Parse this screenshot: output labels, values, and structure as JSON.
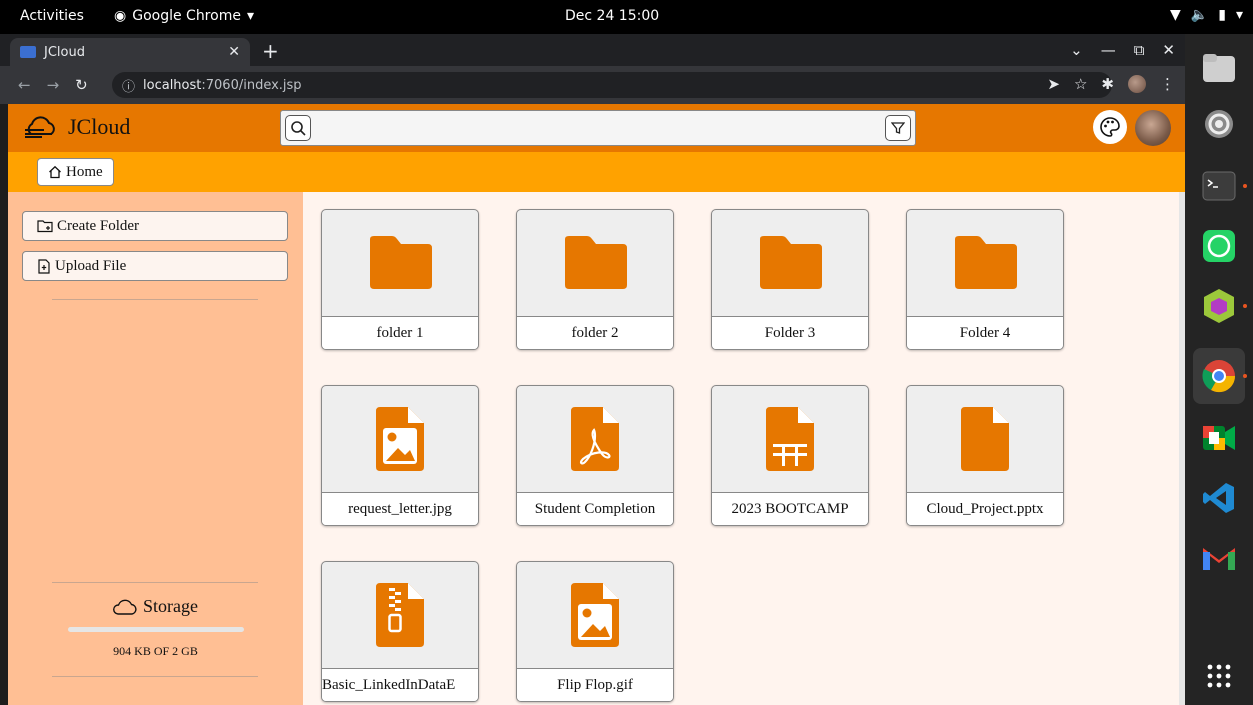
{
  "gnome": {
    "activities": "Activities",
    "app_name": "Google Chrome",
    "clock": "Dec 24  15:00"
  },
  "browser": {
    "tab_title": "JCloud",
    "url_host": "localhost",
    "url_rest": ":7060/index.jsp"
  },
  "app": {
    "name": "JCloud",
    "search_value": "",
    "breadcrumb_home": "Home",
    "sidebar": {
      "create_folder": "Create Folder",
      "upload_file": "Upload File"
    },
    "storage": {
      "title": "Storage",
      "usage_text": "904 KB OF 2 GB",
      "used_fraction": 0.00043
    },
    "items": [
      {
        "name": "folder 1",
        "type": "folder"
      },
      {
        "name": "folder 2",
        "type": "folder"
      },
      {
        "name": "Folder 3",
        "type": "folder"
      },
      {
        "name": "Folder 4",
        "type": "folder"
      },
      {
        "name": "request_letter.jpg",
        "type": "image"
      },
      {
        "name": "Student Completion",
        "type": "pdf"
      },
      {
        "name": "2023 BOOTCAMP",
        "type": "spreadsheet"
      },
      {
        "name": "Cloud_Project.pptx",
        "type": "file"
      },
      {
        "name": "Basic_LinkedInDataE",
        "type": "zip"
      },
      {
        "name": "Flip Flop.gif",
        "type": "image"
      }
    ]
  },
  "colors": {
    "header": "#e67700",
    "breadcrumb_bar": "#ffa200",
    "sidebar": "#ffbf94",
    "content_bg": "#fff4ee",
    "icon_orange": "#e67700"
  },
  "dock_icons": [
    "files-icon",
    "settings-icon",
    "terminal-icon",
    "whatsapp-icon",
    "app-cube-icon",
    "chrome-icon",
    "google-meet-icon",
    "vscode-icon",
    "gmail-icon",
    "app-grid-icon"
  ]
}
